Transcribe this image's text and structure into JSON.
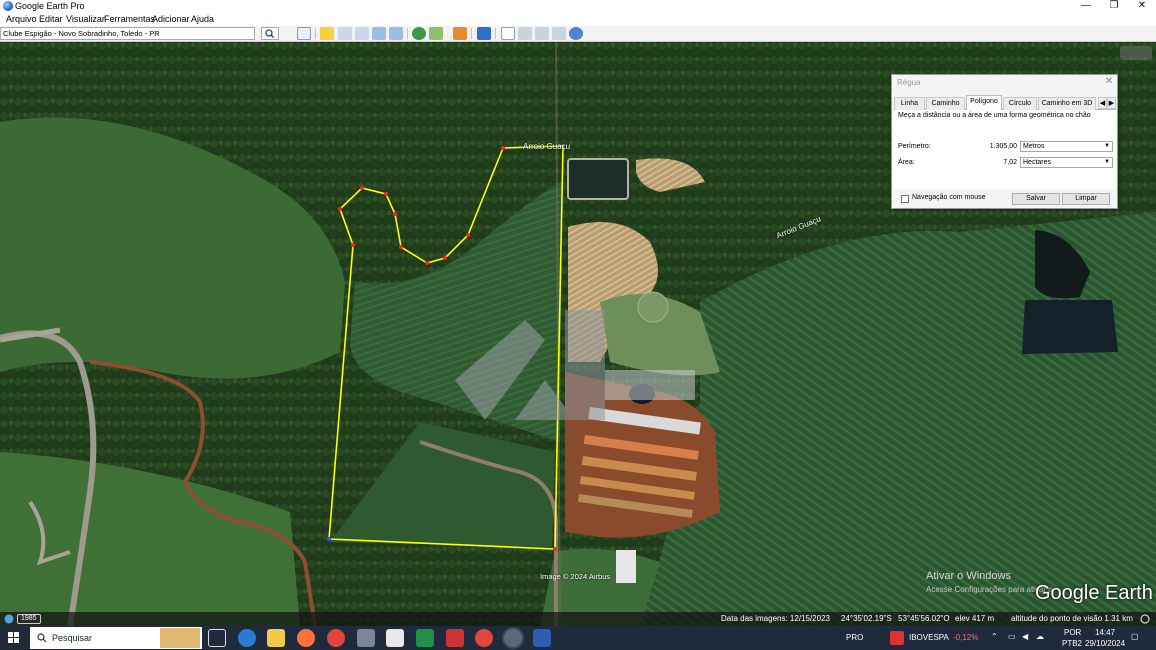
{
  "window": {
    "title": "Google Earth Pro",
    "controls": {
      "minimize": "—",
      "restore": "❐",
      "close": "✕"
    }
  },
  "menu": {
    "items": [
      "Arquivo",
      "Editar",
      "Visualizar",
      "Ferramentas",
      "Adicionar",
      "Ajuda"
    ]
  },
  "search": {
    "value": "Clube Espigão - Novo Sobradinho, Toledo - PR"
  },
  "map": {
    "labels": {
      "stream_top": "Arroio Guaçu",
      "stream_right": "Arroio Guaçu"
    },
    "imagery_credit": "Image © 2024 Airbus",
    "activate_windows": {
      "line1": "Ativar o Windows",
      "line2": "Acesse Configurações para ativar o"
    },
    "logo": "Google Earth",
    "colors": {
      "measure_line": "#ffff00",
      "vertex": "#ff2020"
    }
  },
  "ruler": {
    "title": "Régua",
    "tabs": [
      "Linha",
      "Caminho",
      "Polígono",
      "Círculo",
      "Caminho em 3D"
    ],
    "active_tab": "Polígono",
    "description": "Meça a distância ou a área de uma forma geométrica no chão",
    "perimeter": {
      "label": "Perímetro:",
      "value": "1.305,00",
      "unit": "Metros"
    },
    "area": {
      "label": "Área:",
      "value": "7,02",
      "unit": "Hectares"
    },
    "mouse_nav_label": "Navegação com mouse",
    "save_label": "Salvar",
    "clear_label": "Limpar"
  },
  "statusbar": {
    "year": "1985",
    "image_date": "Data das imagens: 12/15/2023",
    "lat": "24°35'02.19\"S",
    "lon": "53°45'56.02\"O",
    "elev": "elev  417 m",
    "eye_alt": "altitude do ponto de visão   1.31 km"
  },
  "taskbar": {
    "search_placeholder": "Pesquisar",
    "lang": "PRO",
    "ticker_name": "IBOVESPA",
    "ticker_change": "-0,12%",
    "keyboard": "POR",
    "keyboard2": "PTB2",
    "time": "14:47",
    "date": "29/10/2024",
    "colors": {
      "ticker_down": "#ff6b6b"
    }
  }
}
